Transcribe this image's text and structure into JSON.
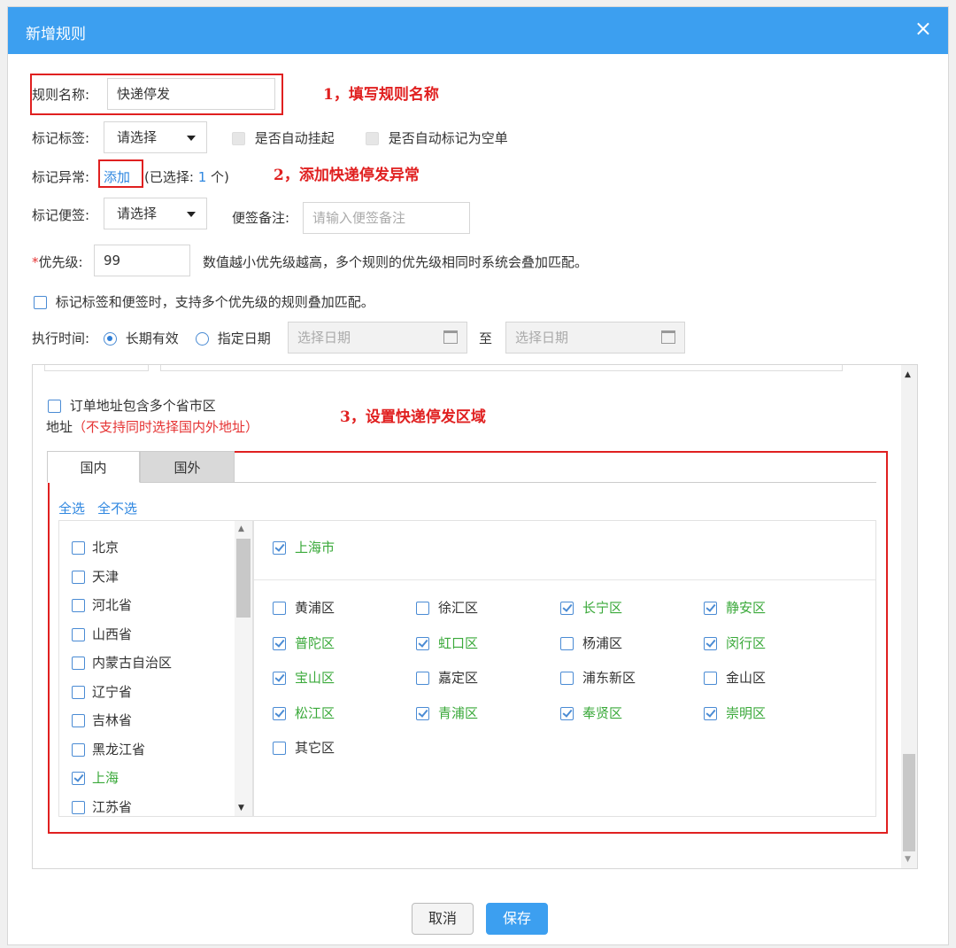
{
  "dialog": {
    "title": "新增规则",
    "close_icon": "×"
  },
  "form": {
    "rule_name_label": "规则名称:",
    "rule_name_value": "快递停发",
    "mark_tag_label": "标记标签:",
    "mark_tag_select": "请选择",
    "auto_suspend_label": "是否自动挂起",
    "auto_empty_label": "是否自动标记为空单",
    "mark_exception_label": "标记异常:",
    "add_link": "添加",
    "selected_prefix": "(已选择:",
    "selected_count": "1",
    "selected_suffix": "个)",
    "mark_note_label": "标记便签:",
    "mark_note_select": "请选择",
    "note_remark_label": "便签备注:",
    "note_remark_placeholder": "请输入便签备注",
    "priority_star": "*",
    "priority_label": "优先级:",
    "priority_value": "99",
    "priority_hint": "数值越小优先级越高，多个规则的优先级相同时系统会叠加匹配。",
    "stack_match_label": "标记标签和便签时，支持多个优先级的规则叠加匹配。",
    "exec_time_label": "执行时间:",
    "long_term_label": "长期有效",
    "specify_date_label": "指定日期",
    "date_placeholder_start": "选择日期",
    "date_to": "至",
    "date_placeholder_end": "选择日期"
  },
  "annotations": {
    "step1": "1，填写规则名称",
    "step2": "2，添加快递停发异常",
    "step3": "3，设置快递停发区域"
  },
  "address": {
    "multi_province_label": "订单地址包含多个省市区",
    "address_label": "地址",
    "address_note": "（不支持同时选择国内外地址）",
    "tabs": [
      "国内",
      "国外"
    ],
    "select_all": "全选",
    "select_none": "全不选",
    "provinces": [
      {
        "name": "北京",
        "checked": false
      },
      {
        "name": "天津",
        "checked": false
      },
      {
        "name": "河北省",
        "checked": false
      },
      {
        "name": "山西省",
        "checked": false
      },
      {
        "name": "内蒙古自治区",
        "checked": false
      },
      {
        "name": "辽宁省",
        "checked": false
      },
      {
        "name": "吉林省",
        "checked": false
      },
      {
        "name": "黑龙江省",
        "checked": false
      },
      {
        "name": "上海",
        "checked": true
      },
      {
        "name": "江苏省",
        "checked": false
      }
    ],
    "city": {
      "name": "上海市",
      "checked": true
    },
    "districts": [
      {
        "name": "黄浦区",
        "checked": false
      },
      {
        "name": "徐汇区",
        "checked": false
      },
      {
        "name": "长宁区",
        "checked": true
      },
      {
        "name": "静安区",
        "checked": true
      },
      {
        "name": "普陀区",
        "checked": true
      },
      {
        "name": "虹口区",
        "checked": true
      },
      {
        "name": "杨浦区",
        "checked": false
      },
      {
        "name": "闵行区",
        "checked": true
      },
      {
        "name": "宝山区",
        "checked": true
      },
      {
        "name": "嘉定区",
        "checked": false
      },
      {
        "name": "浦东新区",
        "checked": false
      },
      {
        "name": "金山区",
        "checked": false
      },
      {
        "name": "松江区",
        "checked": true
      },
      {
        "name": "青浦区",
        "checked": true
      },
      {
        "name": "奉贤区",
        "checked": true
      },
      {
        "name": "崇明区",
        "checked": true
      },
      {
        "name": "其它区",
        "checked": false
      }
    ]
  },
  "footer": {
    "cancel": "取消",
    "save": "保存"
  },
  "colors": {
    "primary": "#3c9ff0",
    "annotation": "#e02020",
    "checked_text": "#3aa93a",
    "link": "#2f87e0"
  }
}
